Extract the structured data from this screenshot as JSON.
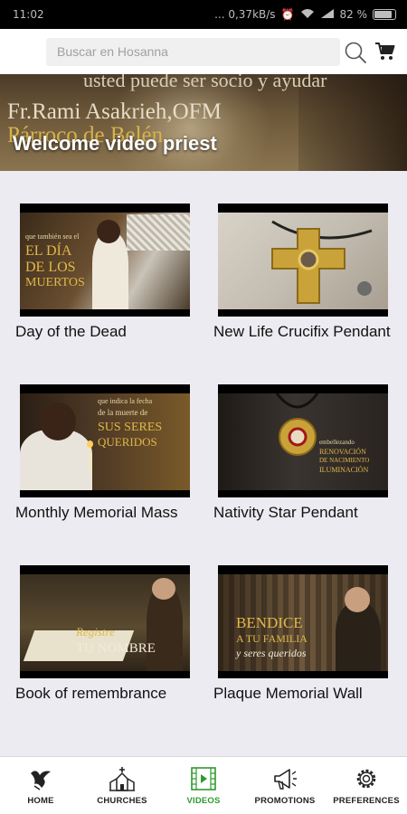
{
  "status_bar": {
    "time": "11:02",
    "network": "... 0,37kB/s",
    "battery": "82 %"
  },
  "search": {
    "placeholder": "Buscar en Hosanna"
  },
  "hero": {
    "overlay_line1": "usted puede ser socio y ayudar",
    "overlay_line2": "Fr.Rami Asakrieh,OFM",
    "overlay_line3": "Párroco de Belén",
    "title": "Welcome video priest"
  },
  "videos": [
    {
      "label": "Day of the Dead",
      "overlay": [
        "que también sea el",
        "EL DÍA",
        "DE LOS",
        "MUERTOS"
      ]
    },
    {
      "label": "New Life Crucifix Pendant",
      "overlay": []
    },
    {
      "label": "Monthly Memorial Mass",
      "overlay": [
        "que indica la fecha",
        "de la muerte de",
        "SUS SERES",
        "QUERIDOS"
      ]
    },
    {
      "label": "Nativity Star Pendant",
      "overlay": [
        "embellezando",
        "RENOVACIÓN",
        "DE NACIMIENTO",
        "ILUMINACIÓN"
      ]
    },
    {
      "label": "Book of remembrance",
      "overlay": [
        "Registre",
        "TU NOMBRE"
      ]
    },
    {
      "label": "Plaque Memorial Wall",
      "overlay": [
        "BENDICE",
        "A TU FAMILIA",
        "y seres queridos"
      ]
    }
  ],
  "nav": [
    {
      "label": "HOME",
      "icon": "dove-icon"
    },
    {
      "label": "CHURCHES",
      "icon": "church-icon"
    },
    {
      "label": "VIDEOS",
      "icon": "video-icon",
      "active": true
    },
    {
      "label": "PROMOTIONS",
      "icon": "megaphone-icon"
    },
    {
      "label": "PREFERENCES",
      "icon": "gear-icon"
    }
  ],
  "colors": {
    "active": "#2e9a2e",
    "background": "#ecebf1",
    "gold": "#d6b34a"
  }
}
